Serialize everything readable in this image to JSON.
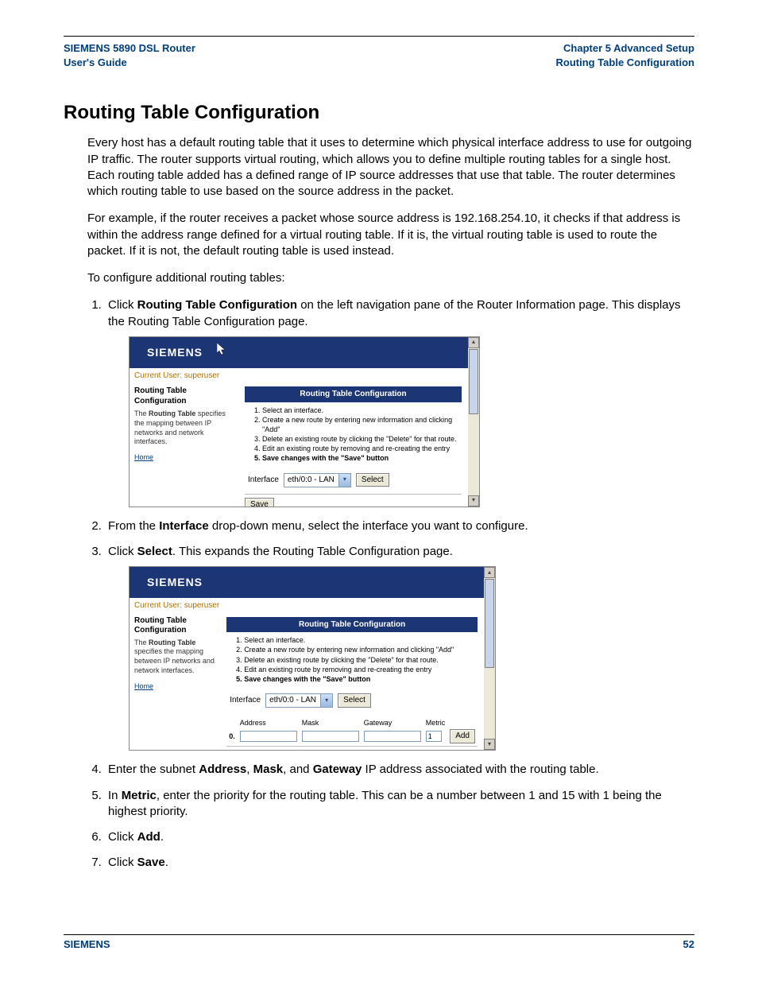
{
  "header": {
    "left_line1": "SIEMENS 5890 DSL Router",
    "left_line2": "User's Guide",
    "right_line1": "Chapter 5  Advanced Setup",
    "right_line2": "Routing Table Configuration"
  },
  "title": "Routing Table Configuration",
  "para1": "Every host has a default routing table that it uses to determine which physical interface address to use for outgoing IP traffic. The router supports virtual routing, which allows you to define multiple routing tables for a single host. Each routing table added has a defined range of IP source addresses that use that table. The router determines which routing table to use based on the source address in the packet.",
  "para2": "For example, if the router receives a packet whose source address is 192.168.254.10, it checks if that address is within the address range defined for a virtual routing table. If it is, the virtual routing table is used to route the packet. If it is not, the default routing table is used instead.",
  "para3": "To configure additional routing tables:",
  "steps": {
    "s1a": "Click ",
    "s1b": "Routing Table Configuration",
    "s1c": " on the left navigation pane of the Router Information page. This displays the Routing Table Configuration page.",
    "s2a": "From the ",
    "s2b": "Interface",
    "s2c": " drop-down menu, select the interface you want to configure.",
    "s3a": "Click ",
    "s3b": "Select",
    "s3c": ". This expands the Routing Table Configuration page.",
    "s4a": "Enter the subnet ",
    "s4b": "Address",
    "s4c": ", ",
    "s4d": "Mask",
    "s4e": ", and ",
    "s4f": "Gateway",
    "s4g": " IP address associated with the routing table.",
    "s5a": "In ",
    "s5b": "Metric",
    "s5c": ", enter the priority for the routing table. This can be a number between 1 and 15 with 1 being the highest priority.",
    "s6a": "Click ",
    "s6b": "Add",
    "s6c": ".",
    "s7a": "Click ",
    "s7b": "Save",
    "s7c": "."
  },
  "shot": {
    "brand": "SIEMENS",
    "current_user_label": "Current User: superuser",
    "left_title": "Routing Table Configuration",
    "left_title_2l": "Routing Table Configuration",
    "left_desc_a": "The ",
    "left_desc_b": "Routing Table",
    "left_desc_c": " specifies the mapping between IP networks and network interfaces.",
    "home": "Home",
    "panel_title": "Routing Table Configuration",
    "instr": {
      "i1": "Select an interface.",
      "i2": "Create a new route by entering new information and clicking \"Add\"",
      "i3": "Delete an existing route by clicking the \"Delete\" for that route.",
      "i4": "Edit an existing route by removing and re-creating the entry",
      "i5": "Save changes with the \"Save\" button"
    },
    "iface_label": "Interface",
    "iface_value": "eth/0:0 - LAN",
    "select_btn": "Select",
    "save_btn": "Save",
    "cols": {
      "address": "Address",
      "mask": "Mask",
      "gateway": "Gateway",
      "metric": "Metric"
    },
    "row": {
      "prefix": "0.",
      "metric_value": "1",
      "add_btn": "Add"
    }
  },
  "footer": {
    "left": "SIEMENS",
    "right": "52"
  }
}
